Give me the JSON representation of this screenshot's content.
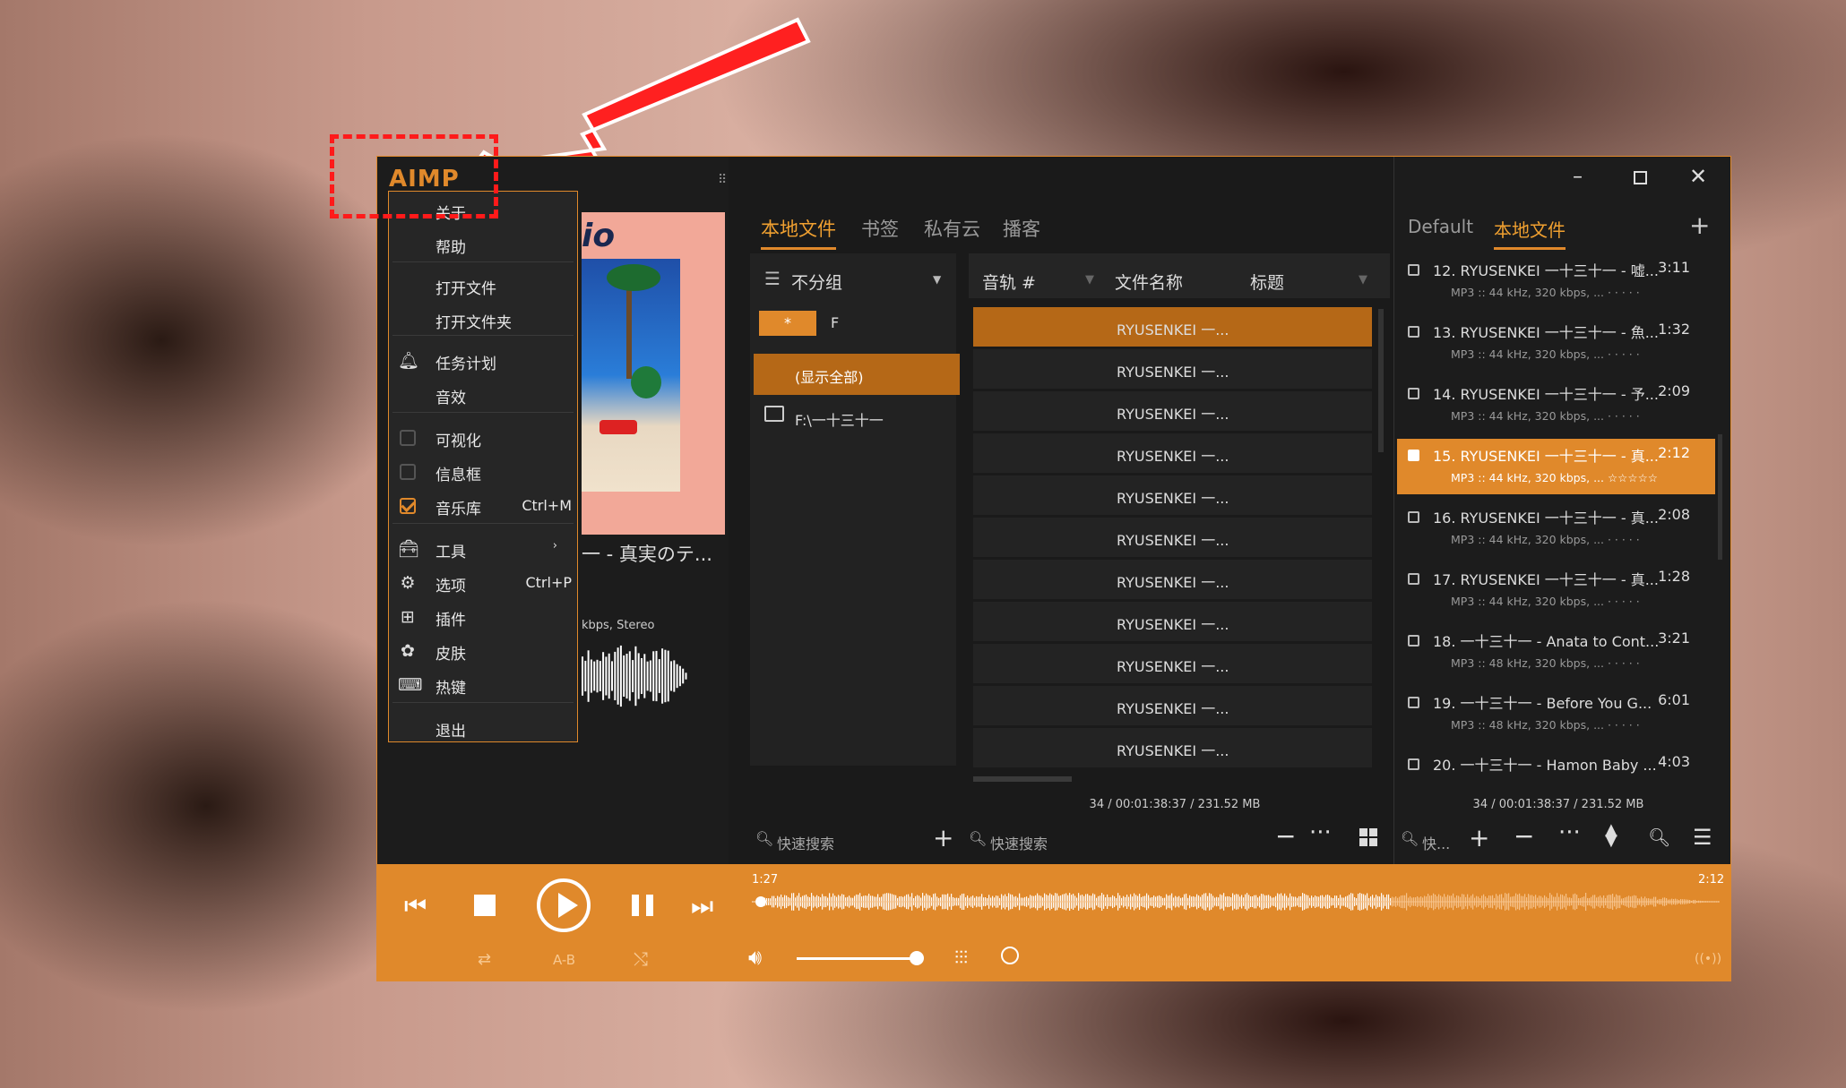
{
  "app": {
    "logo": "AIMP"
  },
  "menu": {
    "items": [
      {
        "label": "关于",
        "shortcut": ""
      },
      {
        "label": "帮助",
        "shortcut": ""
      },
      {
        "label": "打开文件",
        "shortcut": ""
      },
      {
        "label": "打开文件夹",
        "shortcut": ""
      },
      {
        "label": "任务计划",
        "shortcut": ""
      },
      {
        "label": "音效",
        "shortcut": ""
      },
      {
        "label": "可视化",
        "shortcut": ""
      },
      {
        "label": "信息框",
        "shortcut": ""
      },
      {
        "label": "音乐库",
        "shortcut": "Ctrl+M"
      },
      {
        "label": "工具",
        "shortcut": ""
      },
      {
        "label": "选项",
        "shortcut": "Ctrl+P"
      },
      {
        "label": "插件",
        "shortcut": ""
      },
      {
        "label": "皮肤",
        "shortcut": ""
      },
      {
        "label": "热键",
        "shortcut": ""
      },
      {
        "label": "退出",
        "shortcut": ""
      }
    ],
    "checked": {
      "visualization": false,
      "infobox": false,
      "library": true
    }
  },
  "nowplaying": {
    "title_partial": "一 - 真実のテ...",
    "info_partial": "kbps, Stereo",
    "cover_text": "io"
  },
  "library": {
    "tabs": [
      "本地文件",
      "书签",
      "私有云",
      "播客"
    ],
    "active_tab": "本地文件",
    "group_label": "不分组",
    "filter_star": "*",
    "filter_letter": "F",
    "show_all": "(显示全部)",
    "folder": "F:\\一十三十一",
    "columns": [
      "音轨 #",
      "文件名称",
      "标题"
    ],
    "tracks": [
      "RYUSENKEI 一...",
      "RYUSENKEI 一...",
      "RYUSENKEI 一...",
      "RYUSENKEI 一...",
      "RYUSENKEI 一...",
      "RYUSENKEI 一...",
      "RYUSENKEI 一...",
      "RYUSENKEI 一...",
      "RYUSENKEI 一...",
      "RYUSENKEI 一...",
      "RYUSENKEI 一..."
    ],
    "status": "34 / 00:01:38:37 / 231.52 MB",
    "search_placeholder_left": "快速搜索",
    "search_placeholder_right": "快速搜索"
  },
  "playlist": {
    "tabs": [
      "Default",
      "本地文件"
    ],
    "active_tab": "本地文件",
    "items": [
      {
        "title": "12. RYUSENKEI 一十三十一 - 嘘...",
        "duration": "3:11",
        "info": "MP3 :: 44 kHz, 320 kbps, ... · · · · ·"
      },
      {
        "title": "13. RYUSENKEI 一十三十一 - 魚...",
        "duration": "1:32",
        "info": "MP3 :: 44 kHz, 320 kbps, ... · · · · ·"
      },
      {
        "title": "14. RYUSENKEI 一十三十一 - 予...",
        "duration": "2:09",
        "info": "MP3 :: 44 kHz, 320 kbps, ... · · · · ·"
      },
      {
        "title": "15. RYUSENKEI 一十三十一 - 真...",
        "duration": "2:12",
        "info": "MP3 :: 44 kHz, 320 kbps, ... ☆☆☆☆☆"
      },
      {
        "title": "16. RYUSENKEI 一十三十一 - 真...",
        "duration": "2:08",
        "info": "MP3 :: 44 kHz, 320 kbps, ... · · · · ·"
      },
      {
        "title": "17. RYUSENKEI 一十三十一 - 真...",
        "duration": "1:28",
        "info": "MP3 :: 44 kHz, 320 kbps, ... · · · · ·"
      },
      {
        "title": "18. 一十三十一 - Anata to Cont...",
        "duration": "3:21",
        "info": "MP3 :: 48 kHz, 320 kbps, ... · · · · ·"
      },
      {
        "title": "19. 一十三十一 - Before You G...",
        "duration": "6:01",
        "info": "MP3 :: 48 kHz, 320 kbps, ... · · · · ·"
      },
      {
        "title": "20. 一十三十一 - Hamon Baby ...",
        "duration": "4:03",
        "info": ""
      }
    ],
    "selected_index": 3,
    "status": "34 / 00:01:38:37 / 231.52 MB",
    "search_placeholder": "快..."
  },
  "player": {
    "time_elapsed": "1:27",
    "time_total": "2:12",
    "progress": 0.66,
    "volume": 0.96,
    "ab_label": "A-B"
  },
  "colors": {
    "accent": "#e0892b",
    "panel": "#1e1e1e",
    "annotation": "#ff0000"
  }
}
